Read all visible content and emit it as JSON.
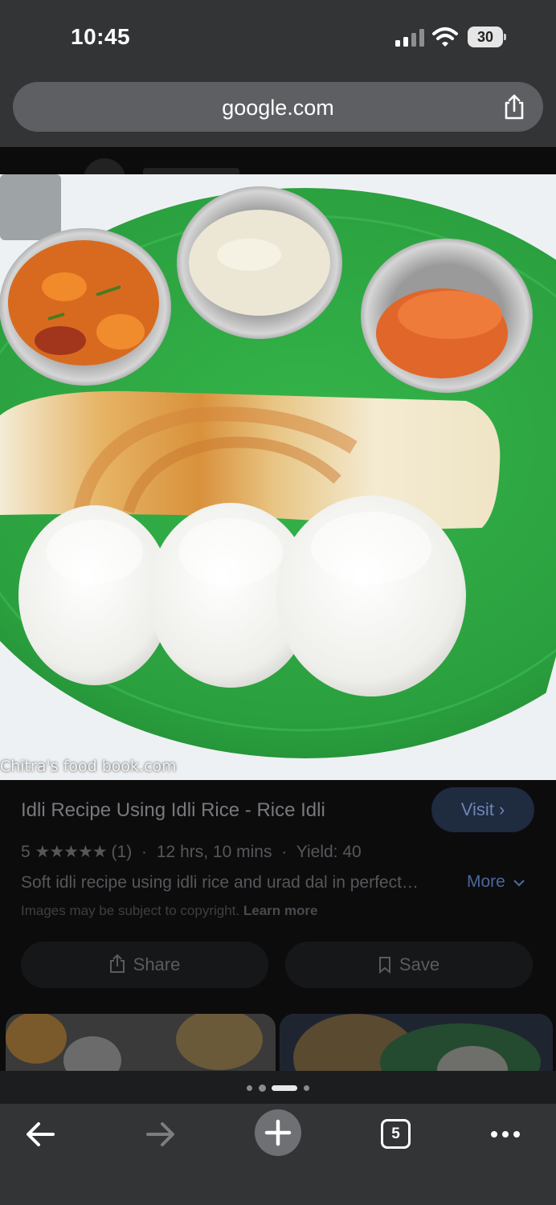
{
  "status_bar": {
    "time": "10:45",
    "battery": "30",
    "icons": [
      "signal-icon",
      "wifi-icon",
      "battery-icon"
    ]
  },
  "url_bar": {
    "url": "google.com",
    "share_icon": "share-icon"
  },
  "image": {
    "description_icon": "food-photo",
    "watermark": "Chitra's food book.com"
  },
  "result": {
    "title": "Idli Recipe Using Idli Rice - Rice Idli",
    "visit_label": "Visit",
    "rating": "5",
    "stars": "★★★★★",
    "rating_count": "(1)",
    "time": "12 hrs, 10 mins",
    "yield": "Yield: 40",
    "separator": "·",
    "description": "Soft idli recipe using idli rice and urad dal in perfect…",
    "more_label": "More",
    "copyright_text": "Images may be subject to copyright.",
    "learn_more": "Learn more",
    "share_label": "Share",
    "save_label": "Save"
  },
  "pagination": {
    "dots": 4,
    "active_index": 2
  },
  "toolbar": {
    "tabs_count": "5",
    "icons": [
      "back-arrow-icon",
      "forward-arrow-icon",
      "new-tab-plus-icon",
      "tabs-icon",
      "more-icon"
    ]
  },
  "colors": {
    "chrome": "#323436",
    "visit_button": "#1f2b3f",
    "link": "#4c6799",
    "plate_green": "#2fa744"
  }
}
